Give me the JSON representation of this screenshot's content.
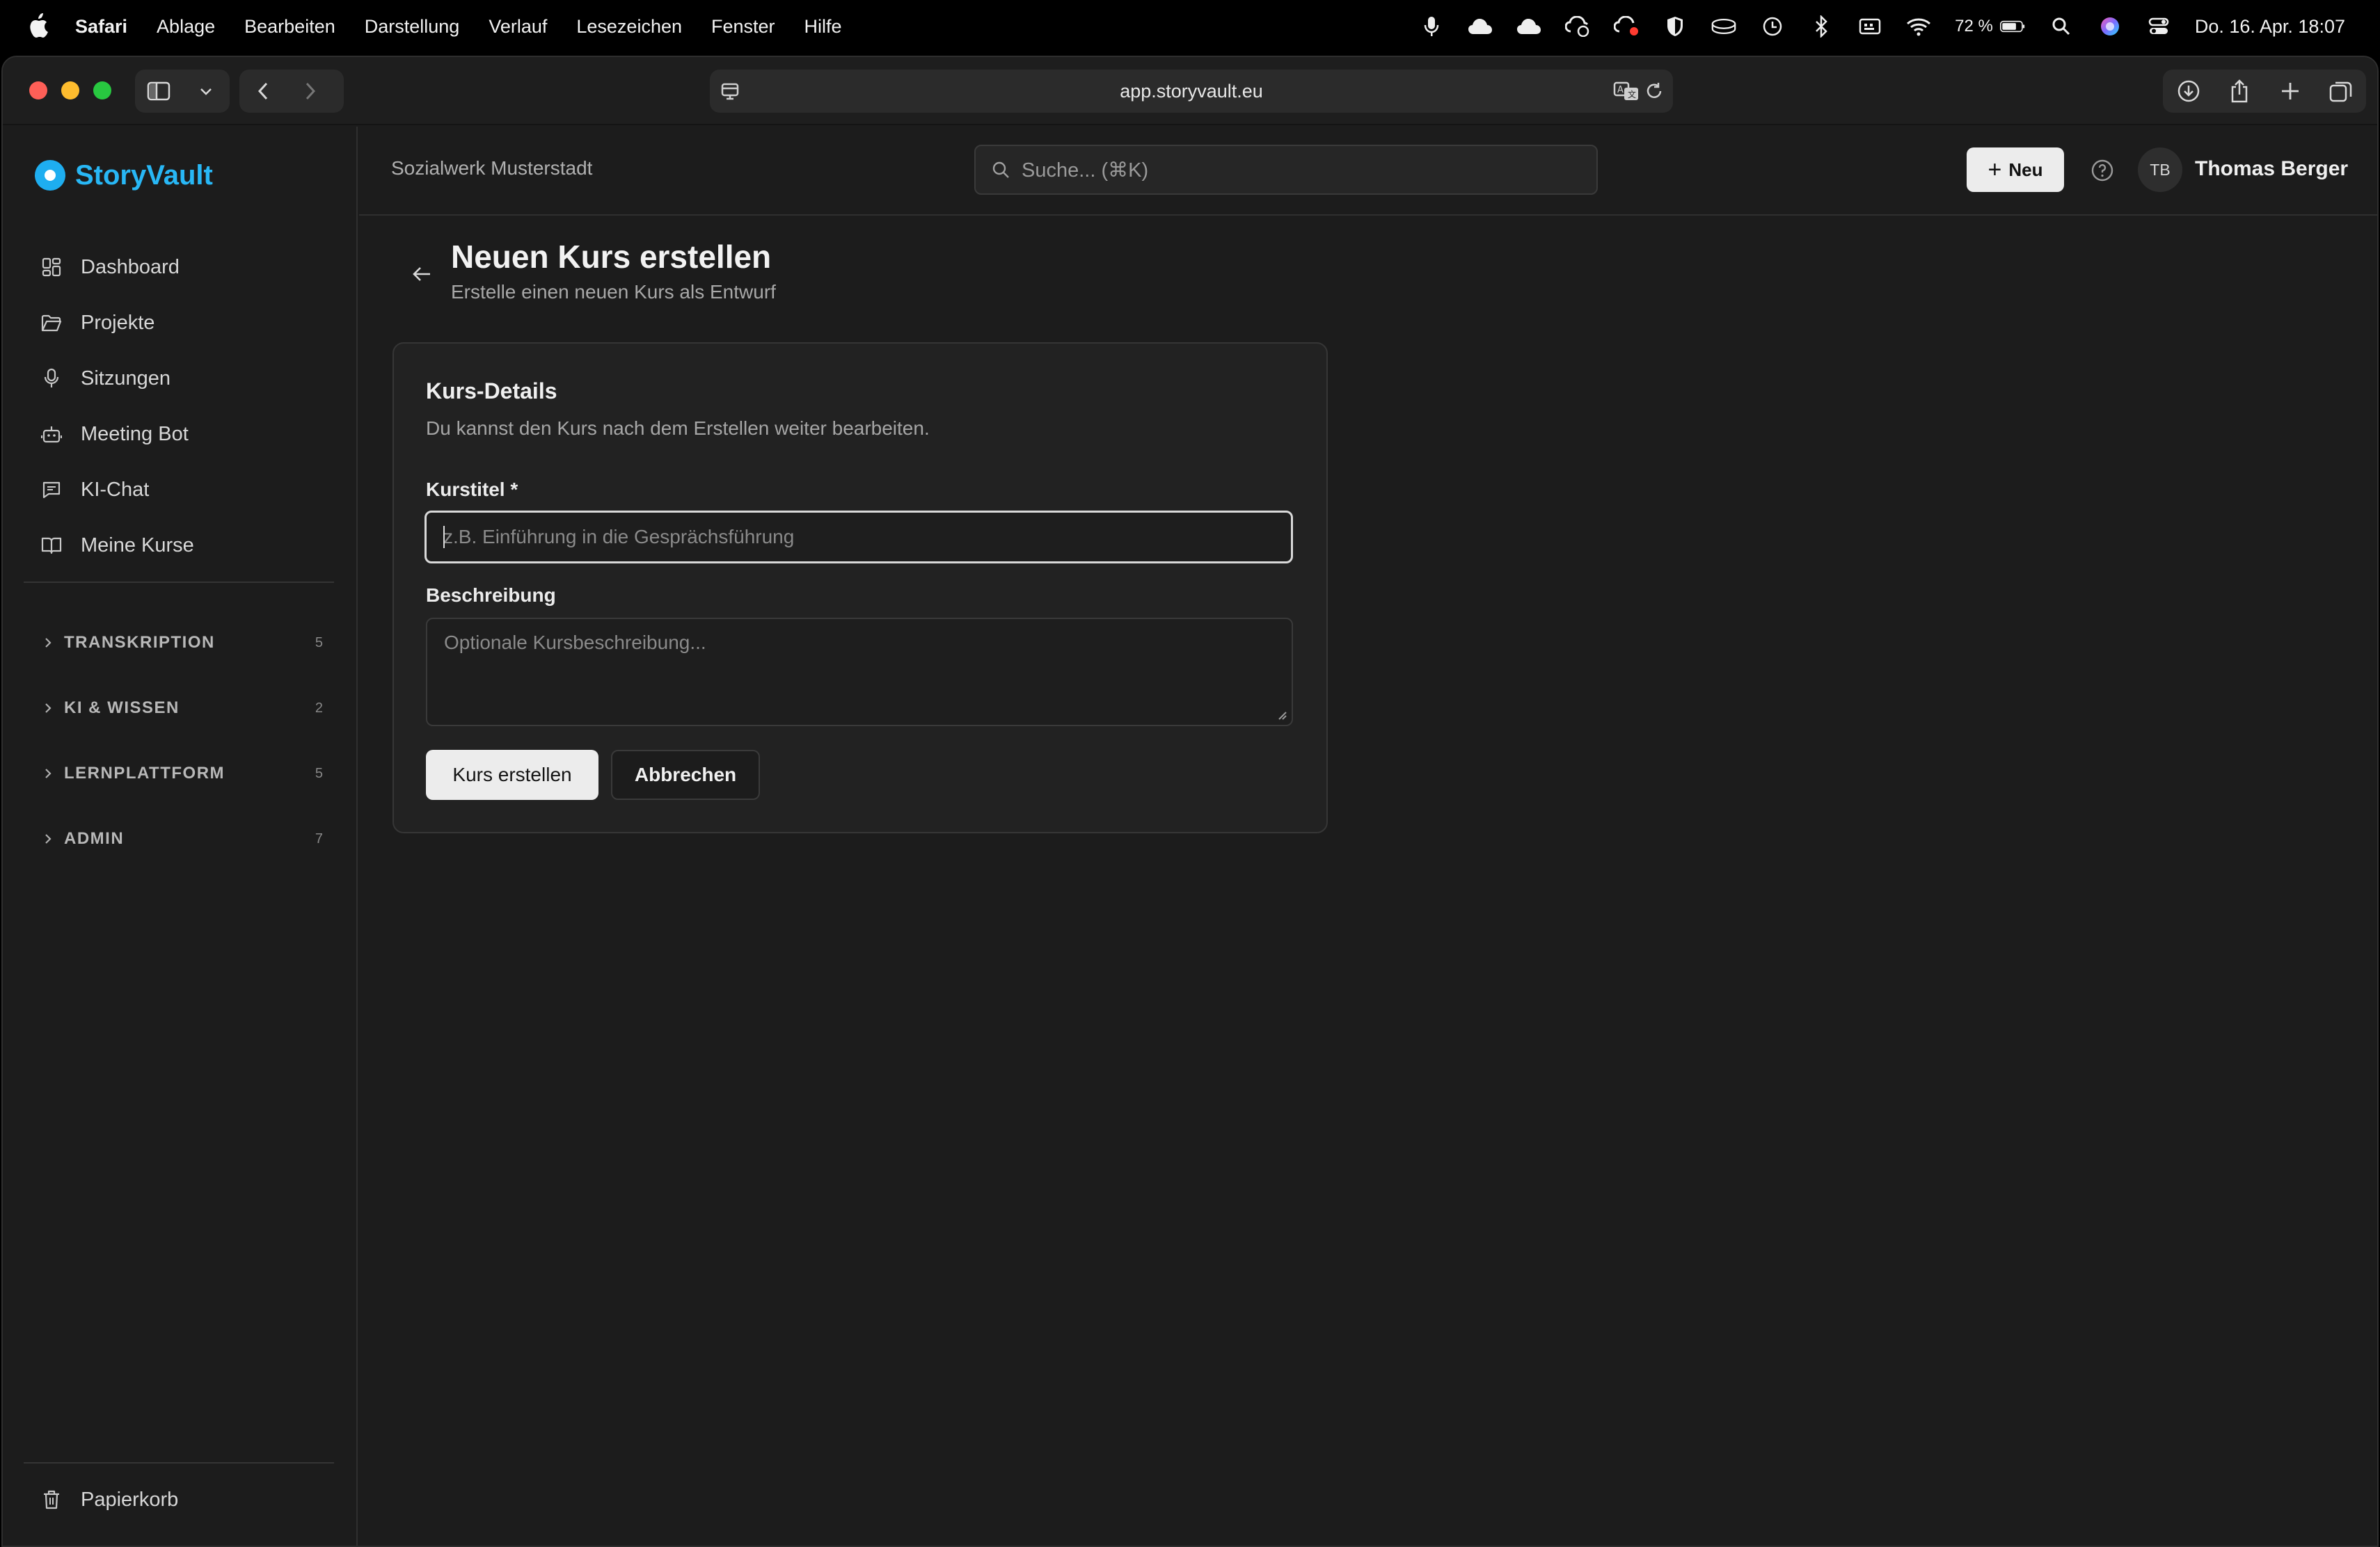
{
  "menubar": {
    "app_name": "Safari",
    "items": [
      "Ablage",
      "Bearbeiten",
      "Darstellung",
      "Verlauf",
      "Lesezeichen",
      "Fenster",
      "Hilfe"
    ],
    "battery": "72 %",
    "clock": "Do. 16. Apr.  18:07"
  },
  "browser": {
    "url": "app.storyvault.eu"
  },
  "sidebar": {
    "brand": "StoryVault",
    "nav": [
      {
        "label": "Dashboard",
        "icon": "dashboard-icon"
      },
      {
        "label": "Projekte",
        "icon": "folder-icon"
      },
      {
        "label": "Sitzungen",
        "icon": "microphone-icon"
      },
      {
        "label": "Meeting Bot",
        "icon": "bot-icon"
      },
      {
        "label": "KI-Chat",
        "icon": "chat-icon"
      },
      {
        "label": "Meine Kurse",
        "icon": "book-icon"
      }
    ],
    "sections": [
      {
        "label": "TRANSKRIPTION",
        "count": "5"
      },
      {
        "label": "KI & WISSEN",
        "count": "2"
      },
      {
        "label": "LERNPLATTFORM",
        "count": "5"
      },
      {
        "label": "ADMIN",
        "count": "7"
      }
    ],
    "trash": "Papierkorb"
  },
  "topbar": {
    "org": "Sozialwerk Musterstadt",
    "search_placeholder": "Suche... (⌘K)",
    "new_label": "Neu",
    "avatar_initials": "TB",
    "user_name": "Thomas Berger"
  },
  "page": {
    "title": "Neuen Kurs erstellen",
    "subtitle": "Erstelle einen neuen Kurs als Entwurf"
  },
  "card": {
    "title": "Kurs-Details",
    "description": "Du kannst den Kurs nach dem Erstellen weiter bearbeiten.",
    "title_label": "Kurstitel *",
    "title_placeholder": "z.B. Einführung in die Gesprächsführung",
    "title_value": "",
    "description_label": "Beschreibung",
    "description_placeholder": "Optionale Kursbeschreibung...",
    "description_value": "",
    "submit_label": "Kurs erstellen",
    "cancel_label": "Abbrechen"
  },
  "colors": {
    "brand": "#28b7f5",
    "background": "#1c1c1c",
    "card": "#222222"
  }
}
